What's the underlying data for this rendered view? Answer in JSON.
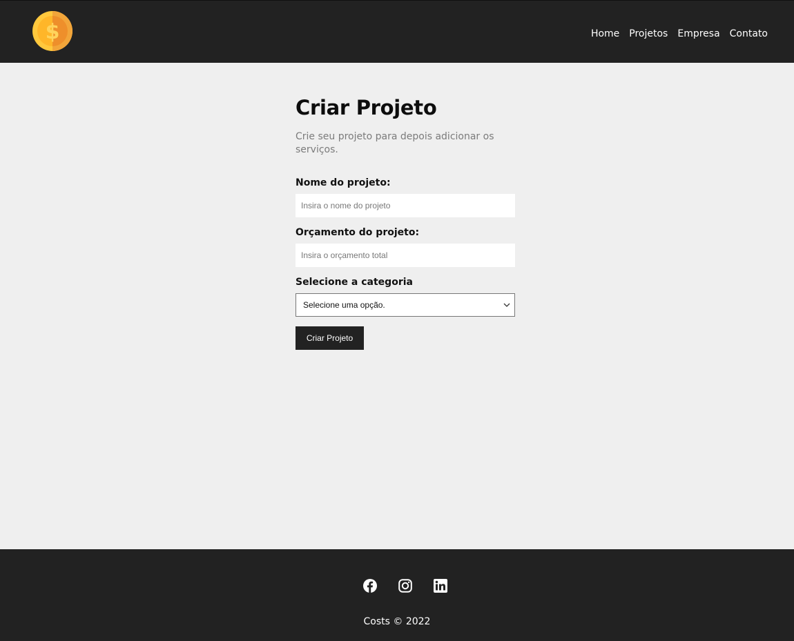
{
  "navbar": {
    "logo_icon": "gold-coin-dollar-icon",
    "links": [
      {
        "label": "Home"
      },
      {
        "label": "Projetos"
      },
      {
        "label": "Empresa"
      },
      {
        "label": "Contato"
      }
    ]
  },
  "page": {
    "title": "Criar Projeto",
    "subtitle": "Crie seu projeto para depois adicionar os serviços."
  },
  "form": {
    "name_label": "Nome do projeto:",
    "name_placeholder": "Insira o nome do projeto",
    "name_value": "",
    "budget_label": "Orçamento do projeto:",
    "budget_placeholder": "Insira o orçamento total",
    "budget_value": "",
    "category_label": "Selecione a categoria",
    "category_selected": "Selecione uma opção.",
    "submit_label": "Criar Projeto"
  },
  "footer": {
    "social_icons": [
      "facebook-icon",
      "instagram-icon",
      "linkedin-icon"
    ],
    "copyright": "Costs © 2022"
  },
  "colors": {
    "navbar_bg": "#222222",
    "page_bg": "#efefef",
    "coin_gold": "#ffbb33",
    "button_bg": "#222222"
  }
}
